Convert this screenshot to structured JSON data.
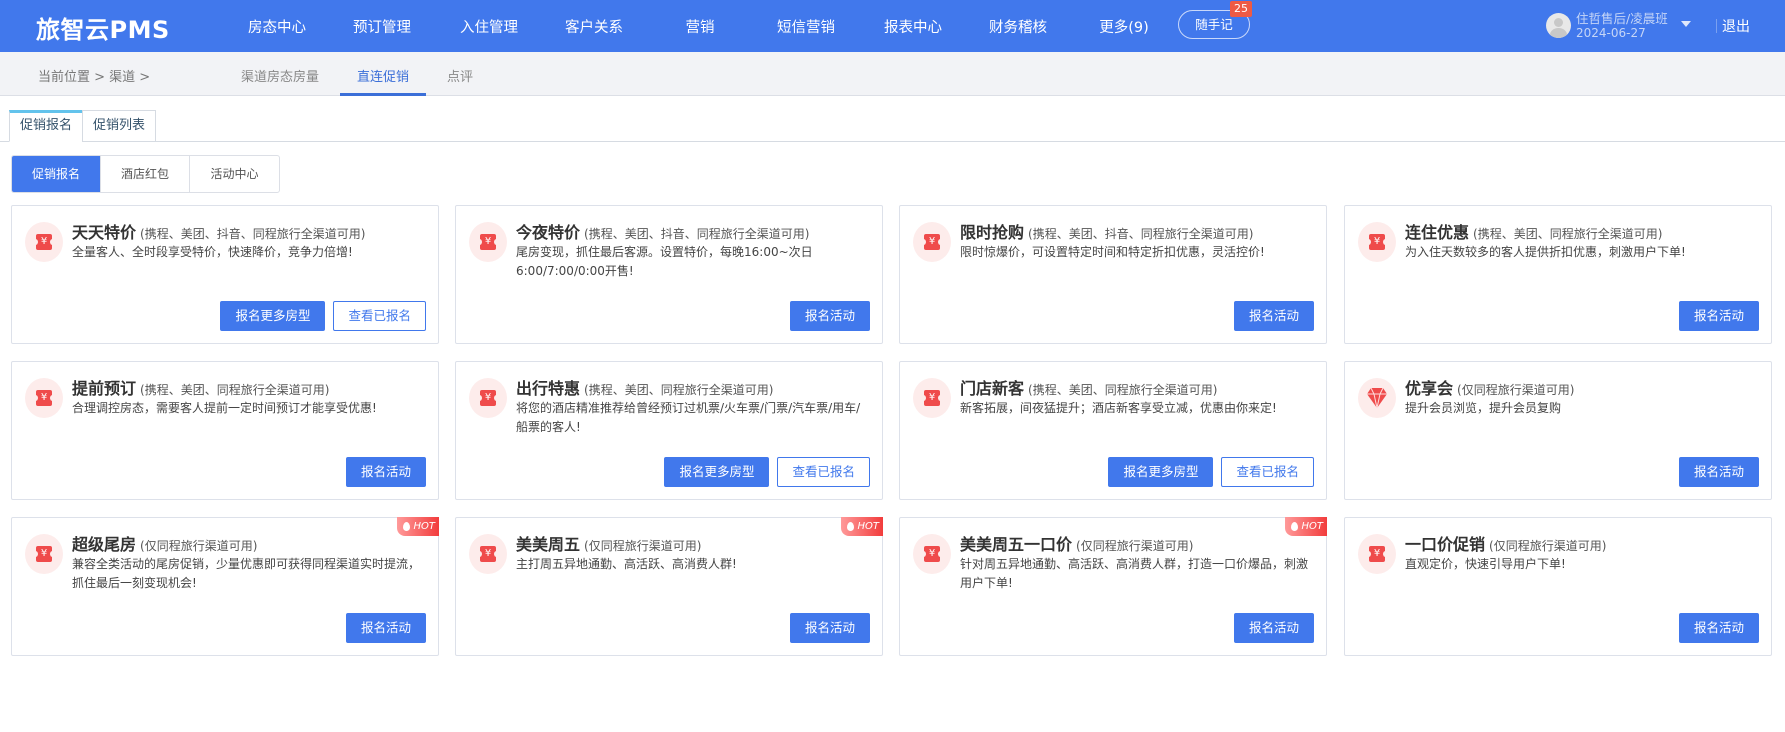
{
  "header": {
    "logo": "旅智云PMS",
    "nav": [
      "房态中心",
      "预订管理",
      "入住管理",
      "客户关系",
      "营销",
      "短信营销",
      "报表中心",
      "财务稽核",
      "更多(9)"
    ],
    "notes_label": "随手记",
    "notes_badge": "25",
    "user": "住哲售后/凌晨班",
    "date": "2024-06-27",
    "logout": "退出"
  },
  "subnav": {
    "breadcrumb": "当前位置 > 渠道 >",
    "tabs": [
      "渠道房态房量",
      "直连促销",
      "点评"
    ],
    "active": "直连促销"
  },
  "tabs": [
    "促销报名",
    "促销列表"
  ],
  "segments": [
    "促销报名",
    "酒店红包",
    "活动中心"
  ],
  "colors": {
    "primary": "#4178ec",
    "icon_red": "#ef4b4b"
  },
  "cards": [
    {
      "title": "天天特价",
      "scope": "(携程、美团、抖音、同程旅行全渠道可用)",
      "desc": "全量客人、全时段享受特价，快速降价，竞争力倍增!",
      "icon": "ticket-icon",
      "hot": false,
      "buttons": [
        "报名更多房型",
        "查看已报名"
      ]
    },
    {
      "title": "今夜特价",
      "scope": "(携程、美团、抖音、同程旅行全渠道可用)",
      "desc": "尾房变现，抓住最后客源。设置特价，每晚16:00~次日6:00/7:00/0:00开售!",
      "icon": "ticket-icon",
      "hot": false,
      "buttons": [
        "报名活动"
      ]
    },
    {
      "title": "限时抢购",
      "scope": "(携程、美团、抖音、同程旅行全渠道可用)",
      "desc": "限时惊爆价，可设置特定时间和特定折扣优惠，灵活控价!",
      "icon": "ticket-icon",
      "hot": false,
      "buttons": [
        "报名活动"
      ]
    },
    {
      "title": "连住优惠",
      "scope": "(携程、美团、同程旅行全渠道可用)",
      "desc": "为入住天数较多的客人提供折扣优惠，刺激用户下单!",
      "icon": "ticket-icon",
      "hot": false,
      "buttons": [
        "报名活动"
      ]
    },
    {
      "title": "提前预订",
      "scope": "(携程、美团、同程旅行全渠道可用)",
      "desc": "合理调控房态，需要客人提前一定时间预订才能享受优惠!",
      "icon": "ticket-icon",
      "hot": false,
      "buttons": [
        "报名活动"
      ]
    },
    {
      "title": "出行特惠",
      "scope": "(携程、美团、同程旅行全渠道可用)",
      "desc": "将您的酒店精准推荐给曾经预订过机票/火车票/门票/汽车票/用车/船票的客人!",
      "icon": "ticket-icon",
      "hot": false,
      "buttons": [
        "报名更多房型",
        "查看已报名"
      ]
    },
    {
      "title": "门店新客",
      "scope": "(携程、美团、同程旅行全渠道可用)",
      "desc": "新客拓展，间夜猛提升；酒店新客享受立减，优惠由你来定!",
      "icon": "ticket-icon",
      "hot": false,
      "buttons": [
        "报名更多房型",
        "查看已报名"
      ]
    },
    {
      "title": "优享会",
      "scope": "(仅同程旅行渠道可用)",
      "desc": "提升会员浏览，提升会员复购",
      "icon": "gem-icon",
      "hot": false,
      "buttons": [
        "报名活动"
      ]
    },
    {
      "title": "超级尾房",
      "scope": "(仅同程旅行渠道可用)",
      "desc": "兼容全类活动的尾房促销，少量优惠即可获得同程渠道实时提流，抓住最后一刻变现机会!",
      "icon": "ticket-icon",
      "hot": true,
      "buttons": [
        "报名活动"
      ]
    },
    {
      "title": "美美周五",
      "scope": "(仅同程旅行渠道可用)",
      "desc": "主打周五异地通勤、高活跃、高消费人群!",
      "icon": "ticket-icon",
      "hot": true,
      "buttons": [
        "报名活动"
      ]
    },
    {
      "title": "美美周五一口价",
      "scope": "(仅同程旅行渠道可用)",
      "desc": "针对周五异地通勤、高活跃、高消费人群，打造一口价爆品，刺激用户下单!",
      "icon": "ticket-icon",
      "hot": true,
      "buttons": [
        "报名活动"
      ]
    },
    {
      "title": "一口价促销",
      "scope": "(仅同程旅行渠道可用)",
      "desc": "直观定价，快速引导用户下单!",
      "icon": "ticket-icon",
      "hot": false,
      "buttons": [
        "报名活动"
      ]
    }
  ],
  "hot_label": "HOT",
  "currency_glyph": "¥"
}
